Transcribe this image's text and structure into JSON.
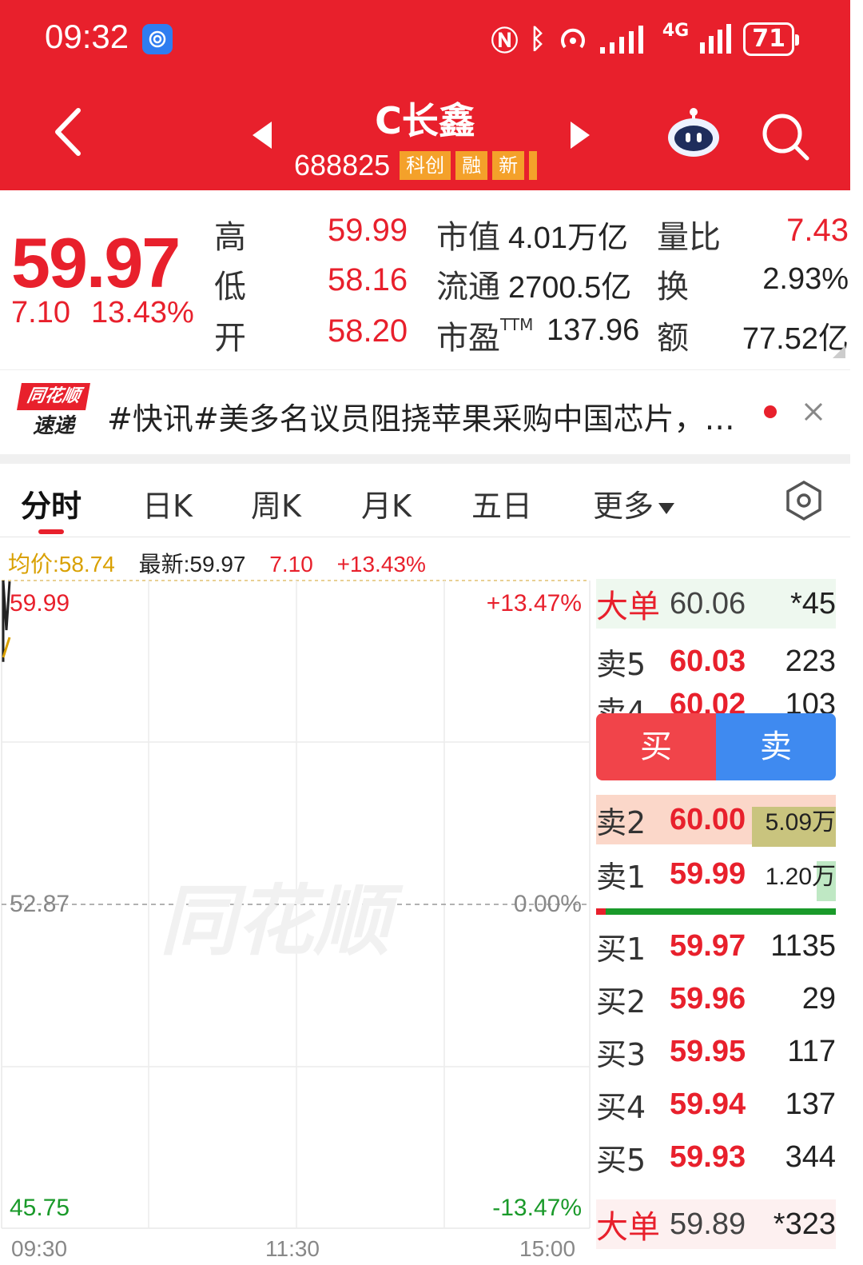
{
  "status_bar": {
    "time": "09:32",
    "network": "4G",
    "battery": "71"
  },
  "header": {
    "stock_name": "C长鑫",
    "stock_code": "688825",
    "tags": [
      "科创",
      "融",
      "新"
    ]
  },
  "quote": {
    "price": "59.97",
    "change": "7.10",
    "change_pct": "13.43%",
    "high_label": "高",
    "high": "59.99",
    "low_label": "低",
    "low": "58.16",
    "open_label": "开",
    "open": "58.20",
    "mktcap_label": "市值",
    "mktcap": "4.01万亿",
    "float_label": "流通",
    "float": "2700.5亿",
    "pe_label": "市盈",
    "pe_sup": "TTM",
    "pe": "137.96",
    "vol_ratio_label": "量比",
    "vol_ratio": "7.43",
    "turnover_label": "换",
    "turnover": "2.93%",
    "amount_label": "额",
    "amount": "77.52亿"
  },
  "news": {
    "logo_top": "同花顺",
    "logo_bottom": "速递",
    "text": "#快讯#美多名议员阻挠苹果采购中国芯片，…"
  },
  "tabs": [
    "分时",
    "日K",
    "周K",
    "月K",
    "五日",
    "更多"
  ],
  "info_line": {
    "avg": "均价:58.74",
    "latest": "最新:59.97",
    "change": "7.10",
    "change_pct": "+13.43%"
  },
  "chart_data": {
    "type": "line",
    "title": "",
    "x_ticks": [
      "09:30",
      "11:30",
      "15:00"
    ],
    "y_ticks_left": [
      "59.99",
      "52.87",
      "45.75"
    ],
    "y_ticks_right": [
      "+13.47%",
      "0.00%",
      "-13.47%"
    ],
    "ylim": [
      45.75,
      59.99
    ],
    "prev_close": 52.87,
    "watermark": "同花顺",
    "series": [
      {
        "values": [
          58.2,
          59.99,
          58.9,
          59.97
        ],
        "x": [
          "09:30",
          "09:30",
          "09:31",
          "09:32"
        ],
        "color": "#222222"
      },
      {
        "values": [
          58.3,
          58.74
        ],
        "x": [
          "09:30",
          "09:32"
        ],
        "color": "#d9a000"
      }
    ]
  },
  "order_book": {
    "big_sell": {
      "label": "大单",
      "price": "60.06",
      "vol": "*45"
    },
    "sell": [
      {
        "label": "卖5",
        "price": "60.03",
        "vol": "223"
      },
      {
        "label": "卖4",
        "price": "60.02",
        "vol": "103"
      },
      {
        "label": "卖2",
        "price": "60.00",
        "vol": "5.09万",
        "bar_fraction": 0.35
      },
      {
        "label": "卖1",
        "price": "59.99",
        "vol": "1.20万",
        "bar_fraction": 0.08
      }
    ],
    "buy": [
      {
        "label": "买1",
        "price": "59.97",
        "vol": "1135"
      },
      {
        "label": "买2",
        "price": "59.96",
        "vol": "29"
      },
      {
        "label": "买3",
        "price": "59.95",
        "vol": "117"
      },
      {
        "label": "买4",
        "price": "59.94",
        "vol": "137"
      },
      {
        "label": "买5",
        "price": "59.93",
        "vol": "344"
      }
    ],
    "big_buy": {
      "label": "大单",
      "price": "59.89",
      "vol": "*323"
    },
    "buy_button": "买",
    "sell_button": "卖"
  }
}
